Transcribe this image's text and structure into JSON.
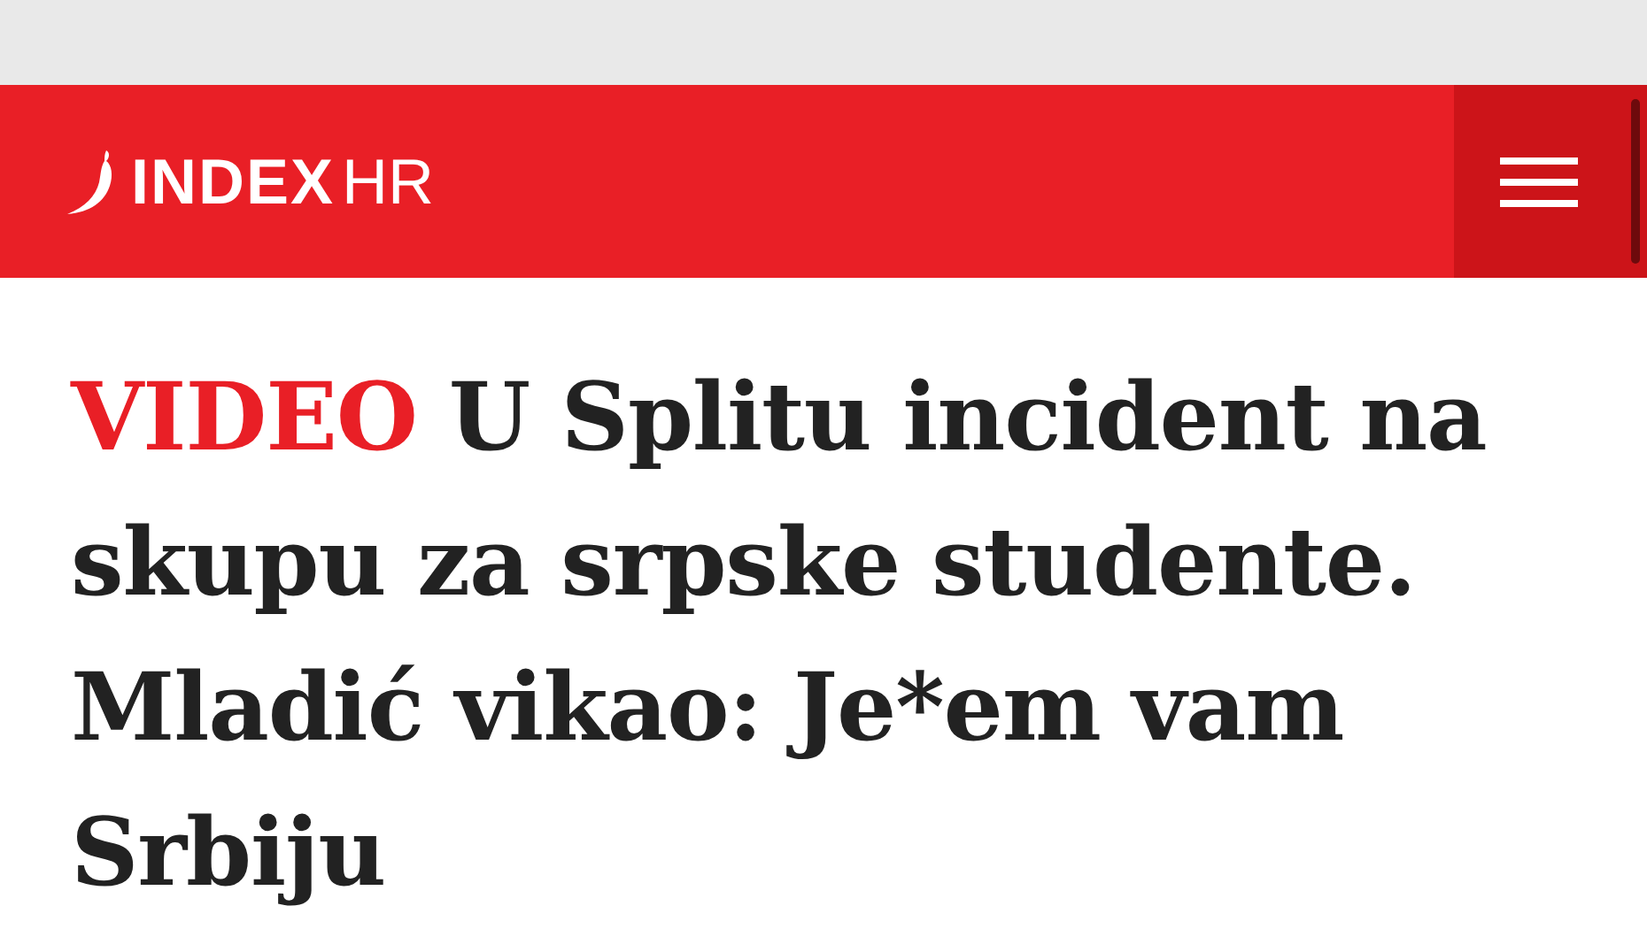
{
  "header": {
    "logo": {
      "bold": "INDEX",
      "light": "HR"
    }
  },
  "article": {
    "tag": "VIDEO",
    "title": "U Splitu incident na skupu za srpske studente. Mladić vikao: Je*em vam Srbiju"
  }
}
